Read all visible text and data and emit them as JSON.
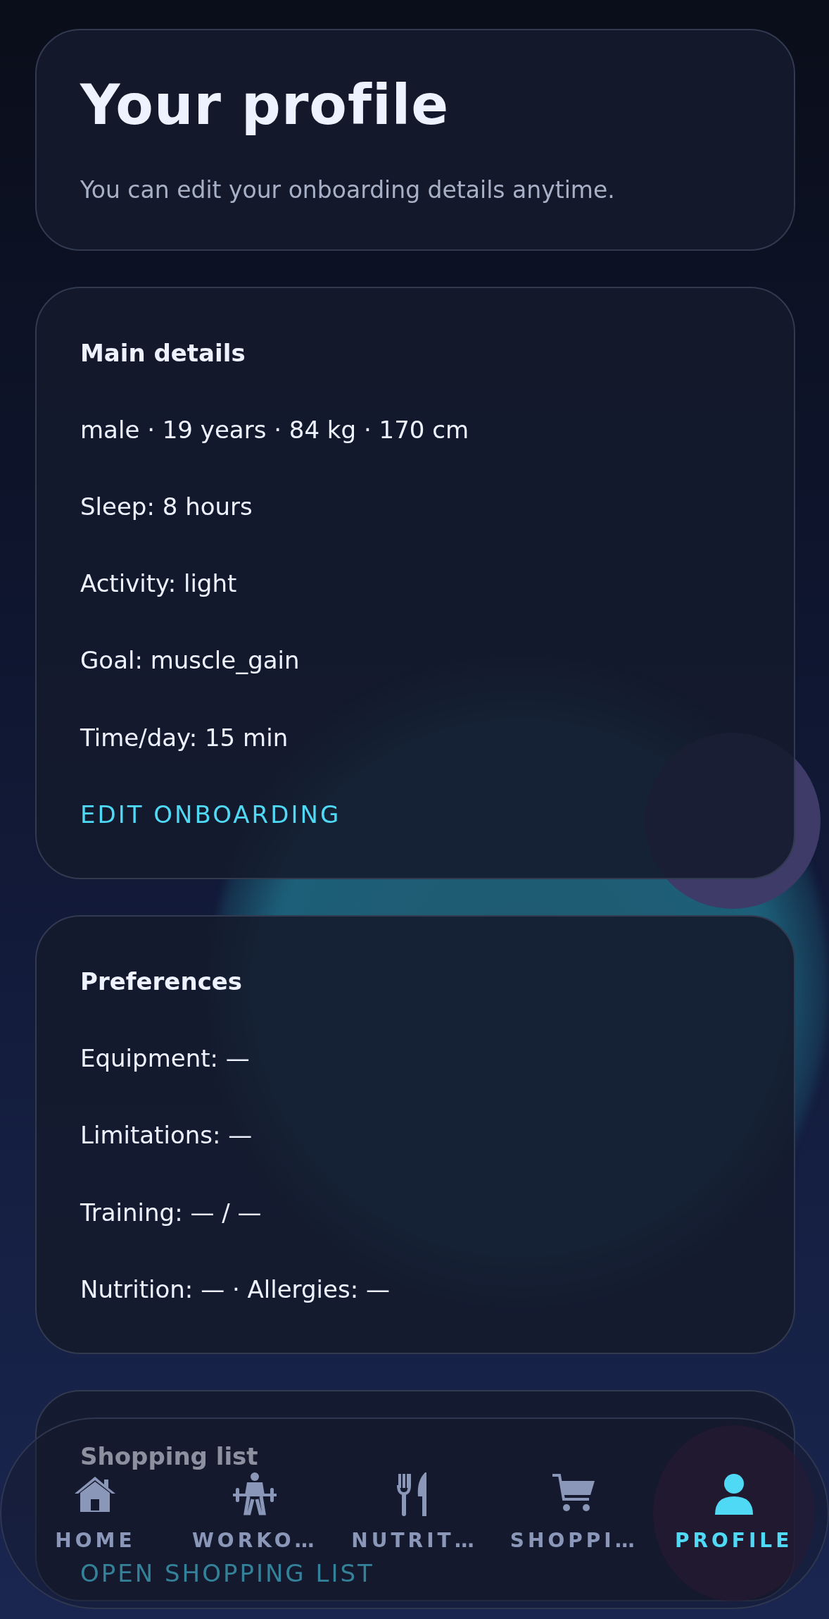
{
  "header": {
    "title": "Your profile",
    "subtitle": "You can edit your onboarding details anytime."
  },
  "cards": [
    {
      "title": "Main details",
      "lines": [
        "male · 19 years · 84 kg · 170 cm",
        "Sleep: 8 hours",
        "Activity: light",
        "Goal: muscle_gain",
        "Time/day: 15 min"
      ],
      "action": "EDIT ONBOARDING"
    },
    {
      "title": "Preferences",
      "lines": [
        "Equipment: —",
        "Limitations: —",
        "Training: — / —",
        "Nutrition: — · Allergies: —"
      ]
    },
    {
      "title": "Shopping list",
      "action": "OPEN SHOPPING LIST"
    }
  ],
  "nav": [
    {
      "kind": "home",
      "label": "HOME",
      "selected": false
    },
    {
      "kind": "workout",
      "label": "WORKO…",
      "selected": false
    },
    {
      "kind": "nutrition",
      "label": "NUTRIT…",
      "selected": false
    },
    {
      "kind": "shopping",
      "label": "SHOPPI…",
      "selected": false
    },
    {
      "kind": "profile",
      "label": "PROFILE",
      "selected": true
    }
  ]
}
